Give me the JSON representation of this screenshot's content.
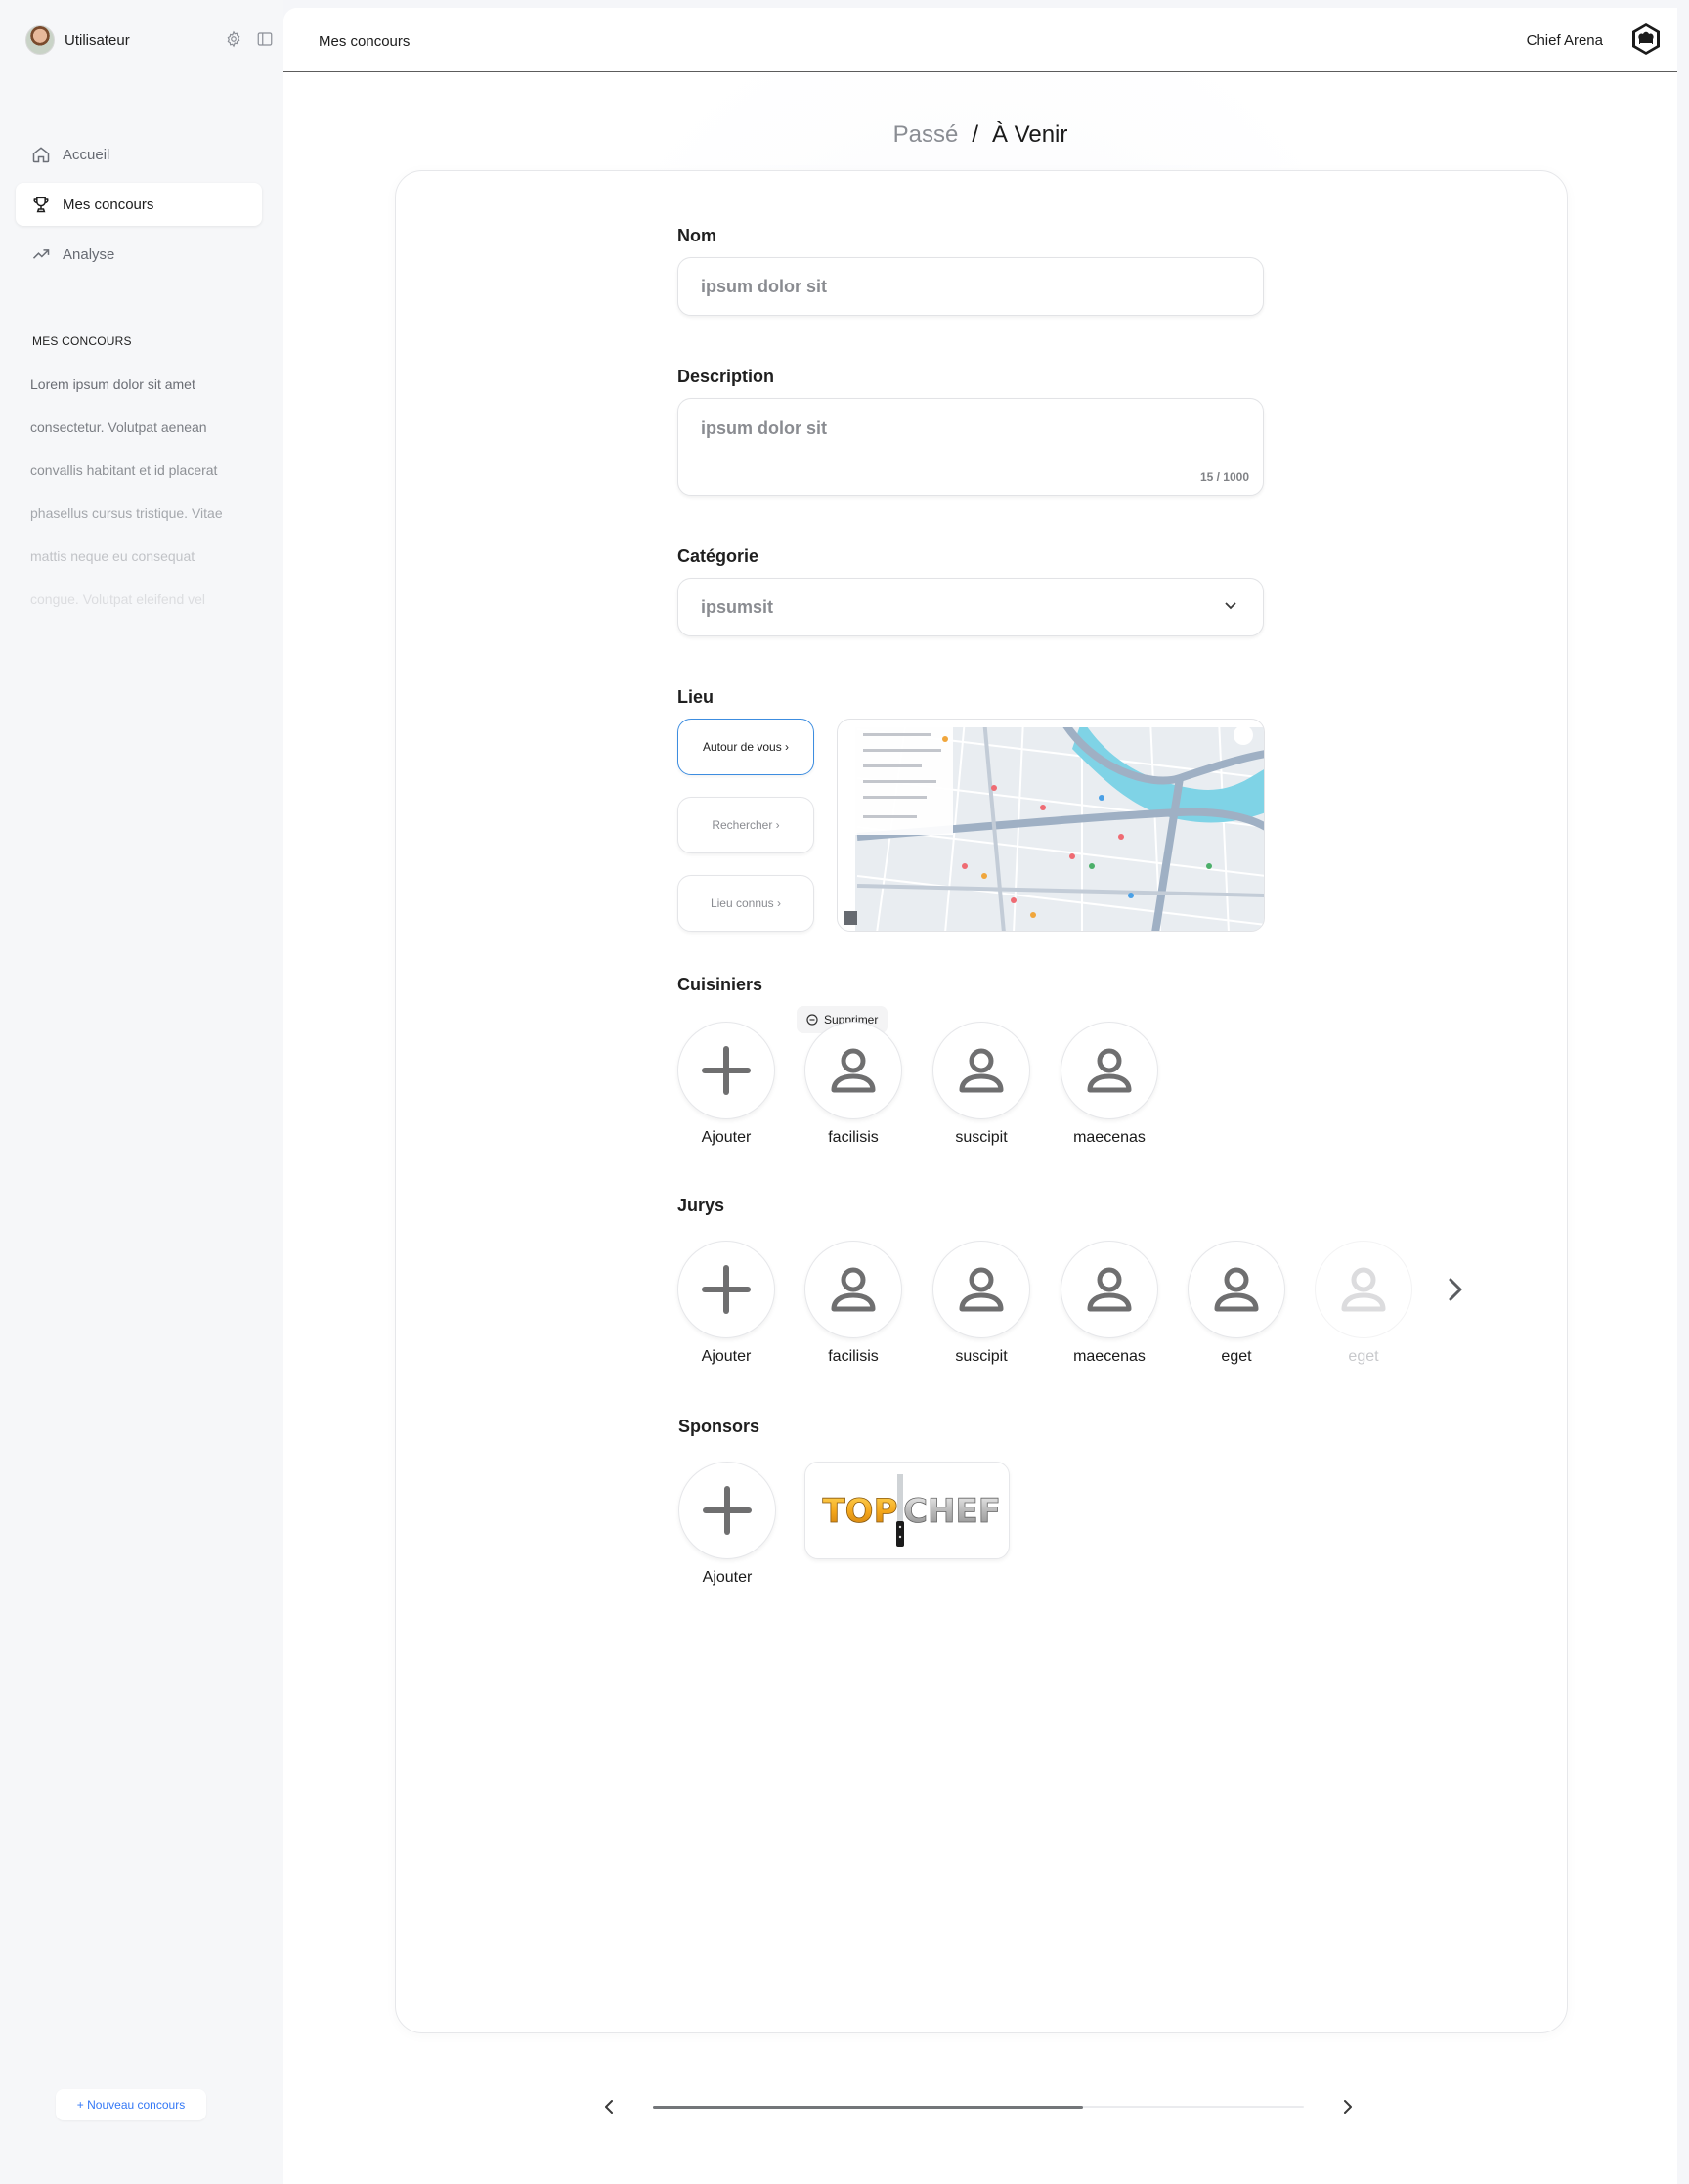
{
  "sidebar": {
    "user_name": "Utilisateur",
    "nav": [
      {
        "label": "Accueil",
        "icon": "home-icon",
        "active": false
      },
      {
        "label": "Mes concours",
        "icon": "trophy-icon",
        "active": true
      },
      {
        "label": "Analyse",
        "icon": "trend-icon",
        "active": false
      }
    ],
    "section_title": "MES CONCOURS",
    "contests": [
      "Lorem ipsum dolor sit amet",
      "consectetur. Volutpat aenean",
      "convallis habitant et id placerat",
      "phasellus cursus tristique. Vitae",
      "mattis neque eu consequat",
      "congue. Volutpat eleifend vel"
    ],
    "new_button": "+ Nouveau concours"
  },
  "header": {
    "breadcrumb": "Mes concours",
    "brand": "Chief Arena"
  },
  "tabs": {
    "past": "Passé",
    "separator": "/",
    "upcoming": "À Venir"
  },
  "form": {
    "name": {
      "label": "Nom",
      "value": "ipsum dolor sit"
    },
    "description": {
      "label": "Description",
      "value": "ipsum dolor sit",
      "counter": "15 / 1000"
    },
    "category": {
      "label": "Catégorie",
      "value": "ipsumsit"
    },
    "location": {
      "label": "Lieu",
      "buttons": [
        "Autour de vous",
        "Rechercher",
        "Lieu connus"
      ],
      "active_index": 0
    },
    "cooks": {
      "label": "Cuisiniers",
      "add_label": "Ajouter",
      "remove_tooltip": "Supprimer",
      "people": [
        "facilisis",
        "suscipit",
        "maecenas"
      ]
    },
    "juries": {
      "label": "Jurys",
      "add_label": "Ajouter",
      "people": [
        "facilisis",
        "suscipit",
        "maecenas",
        "eget"
      ],
      "faded": "eget"
    },
    "sponsors": {
      "label": "Sponsors",
      "add_label": "Ajouter",
      "logo_text_left": "TOP",
      "logo_text_right": "CHEF"
    }
  },
  "pager": {
    "progress": 0.66
  },
  "colors": {
    "accent": "#3478f6",
    "active_border": "#3d8de0",
    "map_water": "#7fd3e6"
  }
}
